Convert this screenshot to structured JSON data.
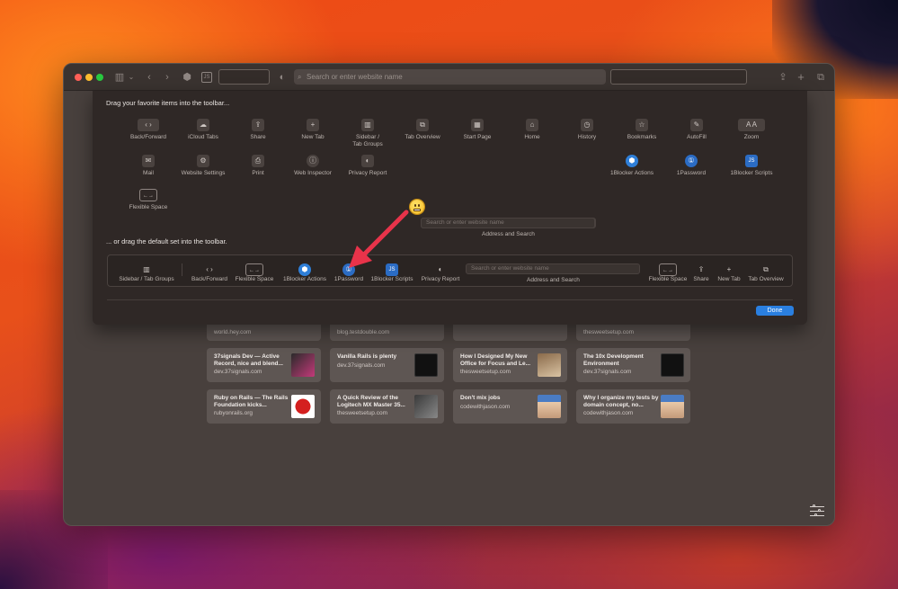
{
  "titlebar": {
    "search_placeholder": "Search or enter website name",
    "js_badge": "JS"
  },
  "customize": {
    "drag_hint": "Drag your favorite items into the toolbar...",
    "default_hint": "... or drag the default set into the toolbar.",
    "done_label": "Done",
    "address_placeholder": "Search or enter website name",
    "address_label": "Address and Search",
    "items_row1": [
      {
        "label": "Back/Forward",
        "icon": "back-forward-icon",
        "glyph": "‹ ›"
      },
      {
        "label": "iCloud Tabs",
        "icon": "cloud-icon",
        "glyph": "☁"
      },
      {
        "label": "Share",
        "icon": "share-icon",
        "glyph": "⇪"
      },
      {
        "label": "New Tab",
        "icon": "plus-icon",
        "glyph": "+"
      },
      {
        "label": "Sidebar /",
        "label2": "Tab Groups",
        "icon": "sidebar-icon",
        "glyph": "▥"
      },
      {
        "label": "Tab Overview",
        "icon": "tab-overview-icon",
        "glyph": "⧉"
      },
      {
        "label": "Start Page",
        "icon": "grid-icon",
        "glyph": "▦"
      },
      {
        "label": "Home",
        "icon": "home-icon",
        "glyph": "⌂"
      },
      {
        "label": "History",
        "icon": "clock-icon",
        "glyph": "◷"
      },
      {
        "label": "Bookmarks",
        "icon": "star-icon",
        "glyph": "☆"
      },
      {
        "label": "AutoFill",
        "icon": "autofill-icon",
        "glyph": "✎"
      },
      {
        "label": "Zoom",
        "icon": "zoom-icon",
        "glyph": "A A"
      }
    ],
    "items_row2": [
      {
        "label": "Mail",
        "icon": "mail-icon",
        "glyph": "✉"
      },
      {
        "label": "Website Settings",
        "icon": "gear-icon",
        "glyph": "⚙"
      },
      {
        "label": "Print",
        "icon": "printer-icon",
        "glyph": "⎙"
      },
      {
        "label": "Web Inspector",
        "icon": "info-icon",
        "glyph": "ⓘ"
      },
      {
        "label": "Privacy Report",
        "icon": "shield-icon",
        "glyph": "◐"
      },
      {
        "label": "1Blocker Actions",
        "icon": "1blocker-icon",
        "glyph": "⬢"
      },
      {
        "label": "1Password",
        "icon": "1password-icon",
        "glyph": "①"
      },
      {
        "label": "1Blocker Scripts",
        "icon": "js-icon",
        "glyph": "JS"
      }
    ],
    "flex_space": {
      "label": "Flexible Space",
      "icon": "flexible-space-icon",
      "glyph": "←→"
    },
    "default_items": [
      {
        "label": "Sidebar / Tab Groups",
        "icon": "sidebar-icon",
        "glyph": "▥"
      },
      {
        "label": "Back/Forward",
        "icon": "back-forward-icon",
        "glyph": "‹ ›"
      },
      {
        "label": "Flexible Space",
        "icon": "flexible-space-icon",
        "glyph": "←→"
      },
      {
        "label": "1Blocker Actions",
        "icon": "1blocker-icon",
        "glyph": "⬢"
      },
      {
        "label": "1Password",
        "icon": "1password-icon",
        "glyph": "①"
      },
      {
        "label": "1Blocker Scripts",
        "icon": "js-icon",
        "glyph": "JS"
      },
      {
        "label": "Privacy Report",
        "icon": "shield-icon",
        "glyph": "◐"
      },
      {
        "label": "Flexible Space",
        "icon": "flexible-space-icon",
        "glyph": "←→"
      },
      {
        "label": "Share",
        "icon": "share-icon",
        "glyph": "⇪"
      },
      {
        "label": "New Tab",
        "icon": "plus-icon",
        "glyph": "+"
      },
      {
        "label": "Tab Overview",
        "icon": "tab-overview-icon",
        "glyph": "⧉"
      }
    ]
  },
  "cards_partial": [
    {
      "url": "world.hey.com"
    },
    {
      "url": "blog.testdouble.com"
    },
    {
      "url": "thesweetsetup.com"
    }
  ],
  "cards": [
    {
      "title": "37signals Dev — Active Record, nice and blend...",
      "url": "dev.37signals.com"
    },
    {
      "title": "Vanilla Rails is plenty",
      "url": "dev.37signals.com"
    },
    {
      "title": "How I Designed My New Office for Focus and Le...",
      "url": "thesweetsetup.com"
    },
    {
      "title": "The 10x Development Environment",
      "url": "dev.37signals.com"
    },
    {
      "title": "Ruby on Rails — The Rails Foundation kicks...",
      "url": "rubyonrails.org"
    },
    {
      "title": "A Quick Review of the Logitech MX Master 35...",
      "url": "thesweetsetup.com"
    },
    {
      "title": "Don't mix jobs",
      "url": "codewithjason.com"
    },
    {
      "title": "Why I organize my tests by domain concept, no...",
      "url": "codewithjason.com"
    }
  ],
  "colors": {
    "accent": "#2a7fe0",
    "arrow": "#e8334a"
  }
}
